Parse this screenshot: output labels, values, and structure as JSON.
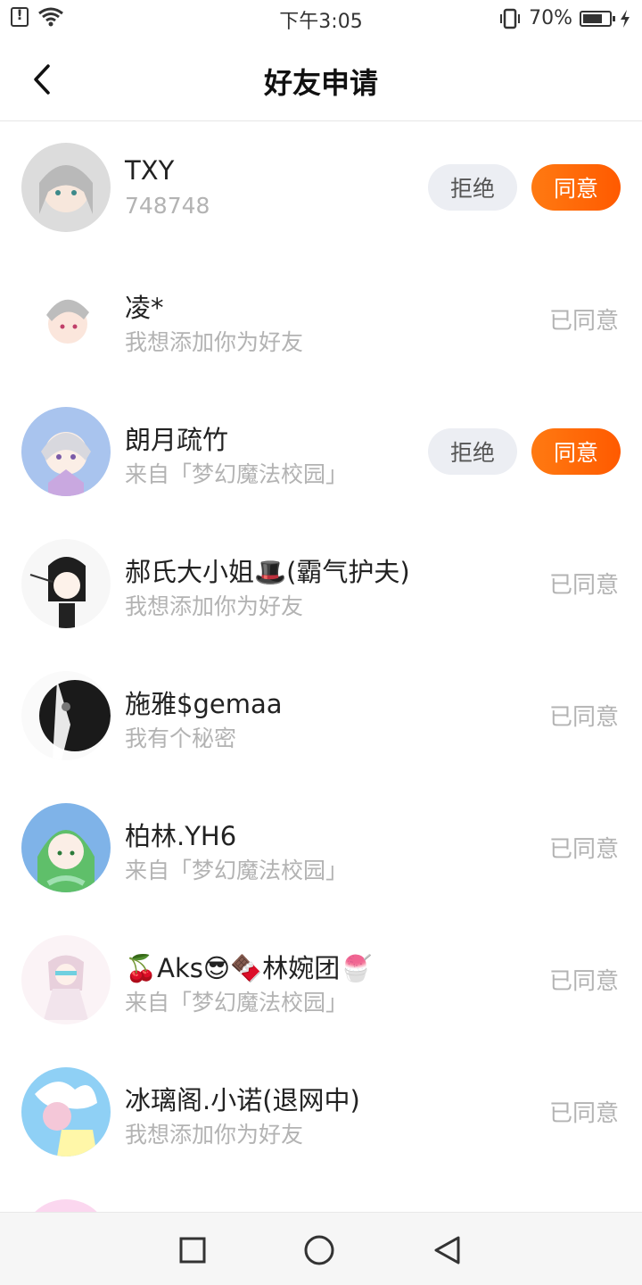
{
  "status_bar": {
    "time": "下午3:05",
    "battery_percent": "70%",
    "icons": [
      "alert-icon",
      "wifi-icon",
      "vibrate-icon",
      "battery-icon",
      "charging-icon"
    ]
  },
  "header": {
    "title": "好友申请",
    "back_icon": "chevron-left-icon"
  },
  "requests": [
    {
      "name": "TXY",
      "sub": "748748",
      "status": "pending",
      "reject_label": "拒绝",
      "accept_label": "同意",
      "avatar_color": "#d9d9d9"
    },
    {
      "name": "凌*",
      "sub": "我想添加你为好友",
      "status": "accepted",
      "status_label": "已同意",
      "avatar_color": "#f4f4f4"
    },
    {
      "name": "朗月疏竹",
      "sub": "来自「梦幻魔法校园」",
      "status": "pending",
      "reject_label": "拒绝",
      "accept_label": "同意",
      "avatar_color": "#a9c4ee"
    },
    {
      "name": "郝氏大小姐🎩(霸气护夫)",
      "sub": "我想添加你为好友",
      "status": "accepted",
      "status_label": "已同意",
      "avatar_color": "#f7f7f7"
    },
    {
      "name": "施雅$gemaa",
      "sub": "我有个秘密",
      "status": "accepted",
      "status_label": "已同意",
      "avatar_color": "#1c1c1c"
    },
    {
      "name": "柏林.YH6",
      "sub": "来自「梦幻魔法校园」",
      "status": "accepted",
      "status_label": "已同意",
      "avatar_color": "#7fb3e8"
    },
    {
      "name": "🍒Aks😎🍫林婉团🍧",
      "sub": "来自「梦幻魔法校园」",
      "status": "accepted",
      "status_label": "已同意",
      "avatar_color": "#fbf3f6"
    },
    {
      "name": "冰璃阁.小诺(退网中)",
      "sub": "我想添加你为好友",
      "status": "accepted",
      "status_label": "已同意",
      "avatar_color": "#8fd0f5"
    }
  ],
  "nav_bar": {
    "icons": [
      "recent-apps-icon",
      "home-icon",
      "back-triangle-icon"
    ]
  },
  "colors": {
    "accent": "#ff6a08",
    "reject_bg": "#eceef3",
    "muted_text": "#b3b3b3"
  }
}
